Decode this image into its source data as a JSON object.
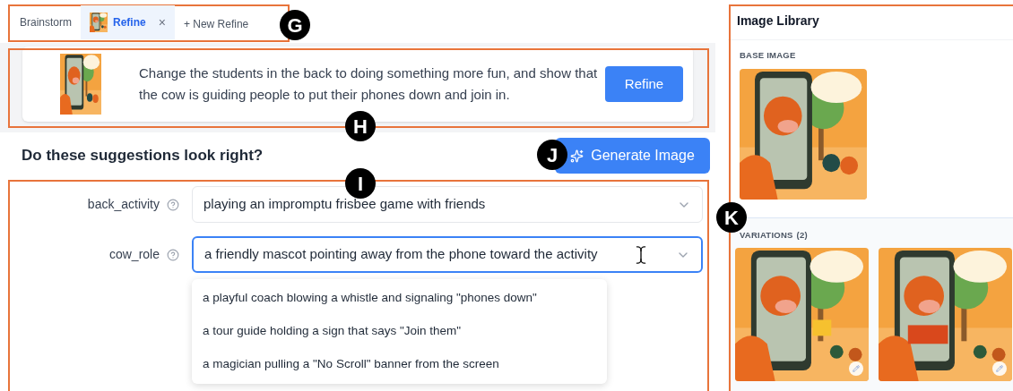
{
  "tabs": [
    {
      "label": "Brainstorm",
      "selected": false,
      "kind": "plain"
    },
    {
      "label": "Refine",
      "selected": true,
      "kind": "thumbnail",
      "close": "×"
    }
  ],
  "new_tab": "+ New Refine",
  "prompt": {
    "text": "Change the students in the back to doing something more fun, and show that the cow is guiding people to put their phones down and join in.",
    "button": "Refine"
  },
  "suggestions": {
    "title": "Do these suggestions look right?",
    "generate_button": "Generate Image",
    "fields": [
      {
        "name": "back_activity",
        "value": "playing an impromptu frisbee game with friends",
        "focused": false
      },
      {
        "name": "cow_role",
        "value": "a friendly mascot pointing away from the phone toward the activity",
        "focused": true,
        "options": [
          "a playful coach blowing a whistle and signaling \"phones down\"",
          "a tour guide holding a sign that says \"Join them\"",
          "a magician pulling a \"No Scroll\" banner from the screen"
        ]
      }
    ]
  },
  "library": {
    "title": "Image Library",
    "base_label": "BASE IMAGE",
    "variations_label": "VARIATIONS",
    "variations_count": "(2)"
  },
  "callouts": [
    {
      "label": "G",
      "kind": "tabs"
    },
    {
      "label": "H",
      "kind": "prompt"
    },
    {
      "label": "I",
      "kind": "fields"
    },
    {
      "label": "J",
      "kind": "generate"
    },
    {
      "label": "K",
      "kind": "library"
    }
  ]
}
